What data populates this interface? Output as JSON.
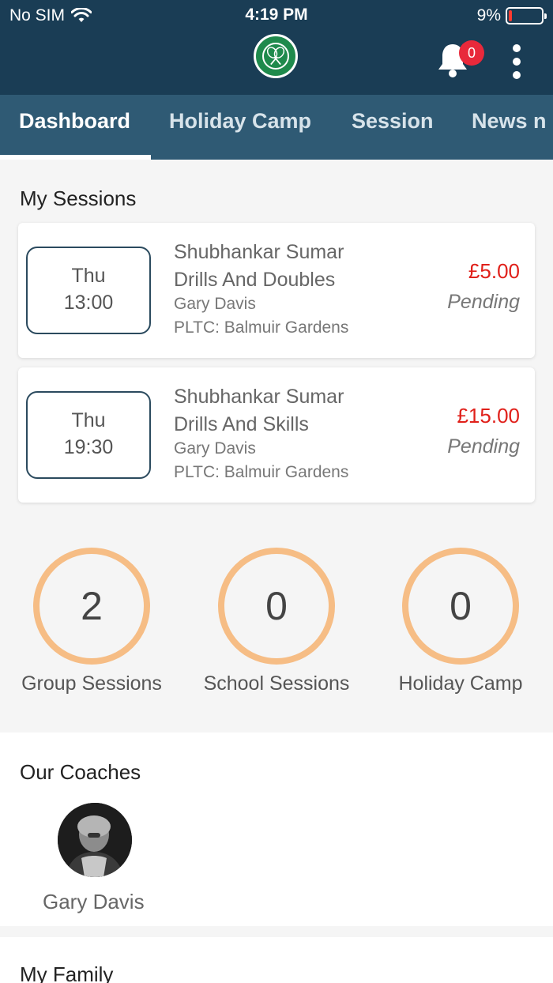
{
  "status_bar": {
    "carrier": "No SIM",
    "time": "4:19 PM",
    "battery_percent": "9%",
    "battery_level": 0.09
  },
  "header": {
    "notification_count": "0",
    "logo_icon": "club-logo-icon",
    "bell_icon": "bell-icon",
    "menu_icon": "more-vertical-icon"
  },
  "tabs": [
    {
      "label": "Dashboard",
      "active": true
    },
    {
      "label": "Holiday Camp",
      "active": false
    },
    {
      "label": "Session",
      "active": false
    },
    {
      "label": "News n",
      "active": false
    }
  ],
  "my_sessions": {
    "title": "My Sessions",
    "items": [
      {
        "day": "Thu",
        "time": "13:00",
        "name": "Shubhankar Sumar",
        "session": "Drills And Doubles",
        "coach": "Gary Davis",
        "venue": "PLTC: Balmuir Gardens",
        "price": "£5.00",
        "status": "Pending"
      },
      {
        "day": "Thu",
        "time": "19:30",
        "name": "Shubhankar Sumar",
        "session": "Drills And Skills",
        "coach": "Gary Davis",
        "venue": "PLTC: Balmuir Gardens",
        "price": "£15.00",
        "status": "Pending"
      }
    ]
  },
  "stats": [
    {
      "value": "2",
      "label": "Group Sessions"
    },
    {
      "value": "0",
      "label": "School Sessions"
    },
    {
      "value": "0",
      "label": "Holiday Camp"
    }
  ],
  "coaches": {
    "title": "Our Coaches",
    "items": [
      {
        "name": "Gary Davis"
      }
    ]
  },
  "family": {
    "title": "My Family"
  },
  "colors": {
    "header": "#1a3d55",
    "tabs": "#2f5a74",
    "price": "#e0201a",
    "ring": "#f6bd85",
    "badge": "#e8293b"
  }
}
